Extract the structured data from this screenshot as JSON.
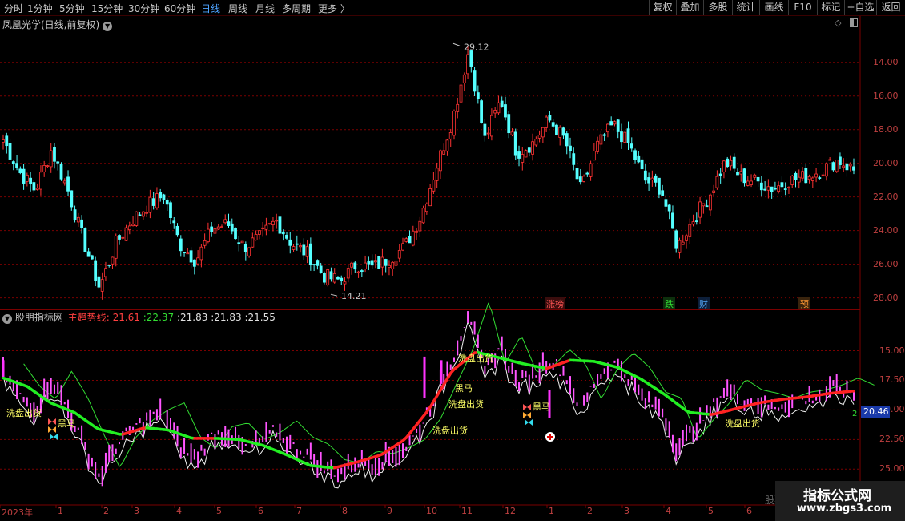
{
  "toolbar": {
    "periods": [
      {
        "label": "分时",
        "active": false
      },
      {
        "label": "1分钟",
        "active": false
      },
      {
        "label": "5分钟",
        "active": false
      },
      {
        "label": "15分钟",
        "active": false
      },
      {
        "label": "30分钟",
        "active": false
      },
      {
        "label": "60分钟",
        "active": false
      },
      {
        "label": "日线",
        "active": true
      },
      {
        "label": "周线",
        "active": false
      },
      {
        "label": "月线",
        "active": false
      },
      {
        "label": "多周期",
        "active": false
      },
      {
        "label": "更多 〉",
        "active": false
      }
    ],
    "buttons": [
      "复权",
      "叠加",
      "多股",
      "统计",
      "画线",
      "F10",
      "标记",
      "+自选",
      "返回"
    ]
  },
  "main_panel": {
    "title": "凤凰光学(日线,前复权)",
    "high_marker": "29.12",
    "low_marker": "14.21",
    "y_ticks": [
      "28.00",
      "26.00",
      "24.00",
      "22.00",
      "20.00",
      "18.00",
      "16.00",
      "14.00"
    ],
    "events": [
      {
        "label": "涨榜",
        "color": "#ff5555"
      },
      {
        "label": "跌",
        "color": "#33dd33"
      },
      {
        "label": "财",
        "color": "#55aaff"
      },
      {
        "label": "预",
        "color": "#ff9933"
      }
    ]
  },
  "indicator_panel": {
    "name": "股朋指标网",
    "line_label": "主趋势线",
    "values": [
      "21.61",
      "22.37",
      "21.83",
      "21.83",
      "21.55"
    ],
    "value_colors": [
      "#ff4040",
      "#33dd33",
      "#e0e0e0",
      "#e0e0e0",
      "#e0e0e0"
    ],
    "y_ticks": [
      "25.00",
      "22.50",
      "20.00",
      "17.50",
      "15.00"
    ],
    "current_value": "20.46",
    "right_digit": "2",
    "labels": [
      "洗盘出货",
      "黑马",
      "洗盘出货",
      "黑马",
      "洗盘出货",
      "洗盘出货",
      "黑马",
      "洗盘出货"
    ]
  },
  "x_axis": {
    "labels": [
      "2023年",
      "1",
      "2",
      "3",
      "4",
      "5",
      "6",
      "7",
      "8",
      "9",
      "10",
      "11",
      "12",
      "1",
      "2",
      "3",
      "4",
      "5",
      "6"
    ]
  },
  "watermark": {
    "title": "指标公式网",
    "url": "www.zbgs3.com",
    "behind_text": "股票"
  },
  "colors": {
    "up": "#ff3333",
    "down": "#54ffff",
    "trend_up": "#ff2222",
    "trend_down": "#22ee22",
    "grid": "#7a0000"
  },
  "chart_data": [
    {
      "type": "candlestick",
      "title": "凤凰光学(日线,前复权)",
      "ylim": [
        13.6,
        29.8
      ],
      "yticks": [
        14,
        16,
        18,
        20,
        22,
        24,
        26,
        28
      ],
      "x_labels": [
        "2023年",
        "1",
        "2",
        "3",
        "4",
        "5",
        "6",
        "7",
        "8",
        "9",
        "10",
        "11",
        "12",
        "1",
        "2",
        "3",
        "4",
        "5",
        "6"
      ],
      "annotations": [
        {
          "label": "29.12",
          "kind": "high"
        },
        {
          "label": "14.21",
          "kind": "low"
        }
      ],
      "close_path": [
        23.4,
        21.5,
        20.4,
        22.8,
        20.5,
        17.4,
        14.6,
        17.2,
        18.6,
        19.5,
        20.1,
        17.2,
        16.2,
        18.1,
        18.4,
        17.0,
        17.6,
        18.6,
        17.2,
        16.6,
        15.3,
        15.0,
        16.0,
        15.8,
        16.3,
        17.0,
        18.8,
        21.8,
        24.6,
        28.7,
        23.4,
        25.8,
        22.6,
        23.2,
        24.6,
        23.4,
        20.4,
        23.0,
        24.3,
        23.1,
        21.0,
        20.5,
        17.0,
        18.7,
        20.1,
        22.1,
        21.2,
        20.9,
        20.5,
        21.0,
        21.2,
        21.6,
        22.2,
        21.6
      ]
    },
    {
      "type": "line",
      "title": "股朋指标网",
      "ylim": [
        13.8,
        27.2
      ],
      "yticks": [
        15,
        17.5,
        20,
        22.5,
        25
      ],
      "series": [
        {
          "name": "主趋势线",
          "values": [
            22.7,
            22.0,
            20.6,
            19.8,
            18.4,
            17.9,
            18.5,
            18.3,
            17.6,
            17.6,
            17.5,
            17.0,
            16.2,
            15.3,
            15.1,
            15.6,
            16.2,
            17.5,
            20.0,
            23.3,
            24.9,
            24.4,
            23.9,
            23.5,
            24.2,
            24.1,
            23.6,
            22.6,
            21.3,
            19.8,
            19.6,
            20.1,
            20.6,
            20.9,
            21.1,
            21.4,
            21.6
          ]
        }
      ]
    }
  ]
}
